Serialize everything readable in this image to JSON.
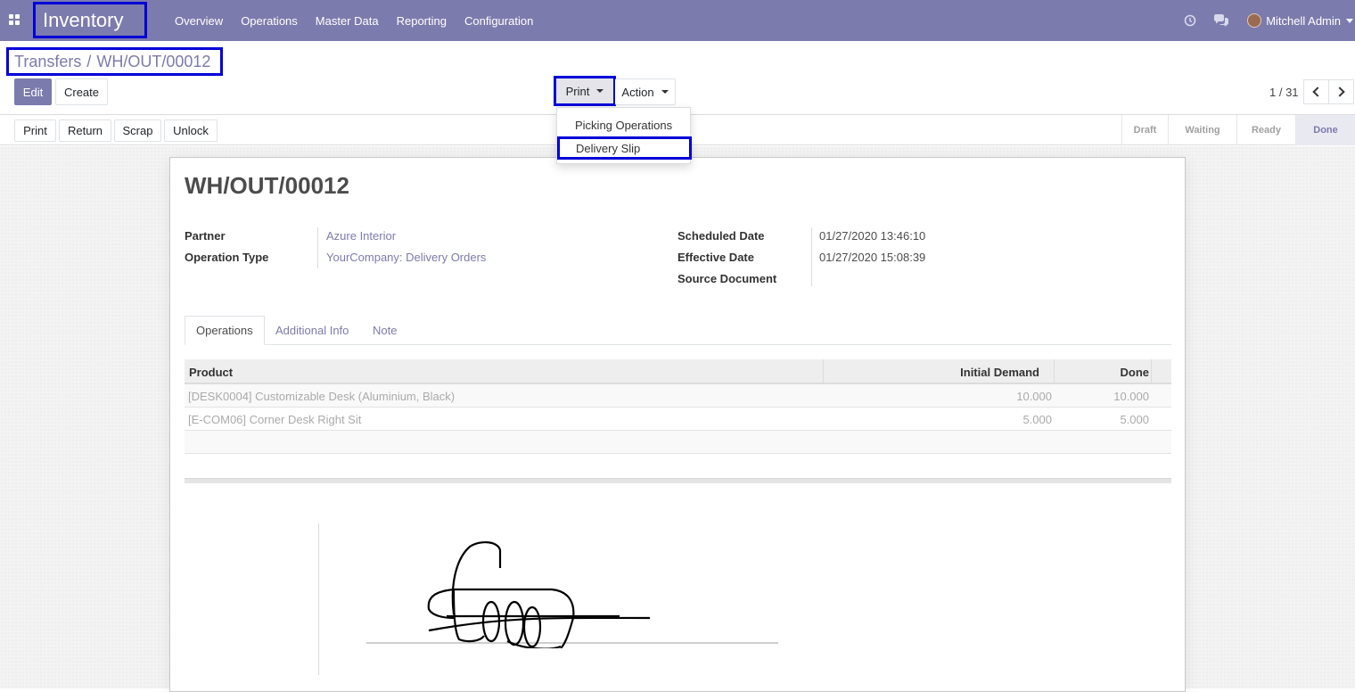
{
  "navbar": {
    "app_title": "Inventory",
    "menu": [
      "Overview",
      "Operations",
      "Master Data",
      "Reporting",
      "Configuration"
    ],
    "user": "Mitchell Admin"
  },
  "control_panel": {
    "breadcrumb": {
      "parent": "Transfers",
      "separator": "/",
      "current": "WH/OUT/00012"
    },
    "edit_label": "Edit",
    "create_label": "Create",
    "print_label": "Print",
    "action_label": "Action",
    "pager": "1 / 31"
  },
  "print_dropdown": {
    "items": [
      "Picking Operations",
      "Delivery Slip"
    ],
    "selected": "Delivery Slip"
  },
  "statusbar": {
    "buttons": [
      "Print",
      "Return",
      "Scrap",
      "Unlock"
    ],
    "stages": [
      "Draft",
      "Waiting",
      "Ready",
      "Done"
    ],
    "active_stage": "Done"
  },
  "record": {
    "title": "WH/OUT/00012",
    "fields_left": [
      {
        "label": "Partner",
        "value": "Azure Interior"
      },
      {
        "label": "Operation Type",
        "value": "YourCompany: Delivery Orders"
      }
    ],
    "fields_right": [
      {
        "label": "Scheduled Date",
        "value": "01/27/2020 13:46:10"
      },
      {
        "label": "Effective Date",
        "value": "01/27/2020 15:08:39"
      },
      {
        "label": "Source Document",
        "value": ""
      }
    ],
    "tabs": [
      "Operations",
      "Additional Info",
      "Note"
    ],
    "active_tab": "Operations",
    "table": {
      "columns": [
        "Product",
        "Initial Demand",
        "Done"
      ],
      "rows": [
        {
          "product": "[DESK0004] Customizable Desk (Aluminium, Black)",
          "initial_demand": "10.000",
          "done": "10.000"
        },
        {
          "product": "[E-COM06] Corner Desk Right Sit",
          "initial_demand": "5.000",
          "done": "5.000"
        }
      ]
    }
  },
  "colors": {
    "brand": "#7c7bad",
    "highlight_box": "#0000d8"
  },
  "icons": [
    "apps-icon",
    "clock-icon",
    "chat-icon",
    "chevron-left-icon",
    "chevron-right-icon"
  ]
}
